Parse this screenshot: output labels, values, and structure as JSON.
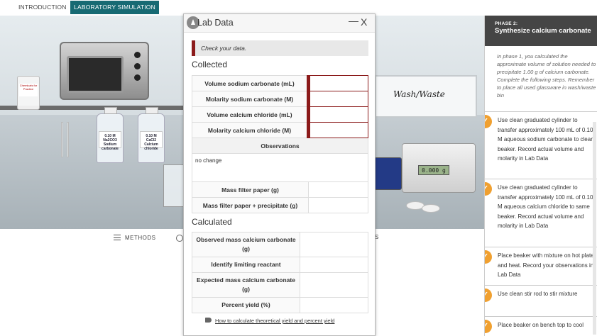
{
  "tabs": {
    "introduction": "INTRODUCTION",
    "simulation": "LABORATORY SIMULATION"
  },
  "scene": {
    "jar_label": "Chemicals for Practice",
    "bottle1_label": "0.10 M Na2CO3 Sodium carbonate",
    "bottle2_label": "0.10 M CaCl2 Calcium chloride",
    "wash_waste": "Wash/Waste",
    "scale_display": "0.000 g"
  },
  "toolbar": {
    "methods": "METHODS",
    "edge_s": "S"
  },
  "lab_data": {
    "title": "Lab Data",
    "minimize": "—",
    "close": "X",
    "notice": "Check your data.",
    "collected_title": "Collected",
    "collected_rows": [
      {
        "label": "Volume sodium carbonate (mL)",
        "value": ""
      },
      {
        "label": "Molarity sodium carbonate (M)",
        "value": ""
      },
      {
        "label": "Volume calcium chloride (mL)",
        "value": ""
      },
      {
        "label": "Molarity calcium chloride (M)",
        "value": ""
      }
    ],
    "observations_label": "Observations",
    "observations_value": "no change",
    "mass_rows": [
      {
        "label": "Mass filter paper (g)",
        "value": ""
      },
      {
        "label": "Mass filter paper + precipitate (g)",
        "value": ""
      }
    ],
    "calculated_title": "Calculated",
    "calculated_rows": [
      {
        "label": "Observed mass calcium carbonate (g)",
        "value": ""
      },
      {
        "label": "Identify limiting reactant",
        "value": ""
      },
      {
        "label": "Expected mass calcium carbonate (g)",
        "value": ""
      },
      {
        "label": "Percent yield (%)",
        "value": ""
      }
    ],
    "help_link": "How to calculate theoretical yield and percent yield"
  },
  "sidebar": {
    "phase_label": "PHASE 2:",
    "phase_title": "Synthesize calcium carbonate",
    "intro": "In phase 1, you calculated the approximate volume of solution needed to precipitate 1.00 g of calcium carbonate. Complete the following steps. Remember to place all used glassware in wash/waste bin",
    "check_glyph": "✓",
    "steps": [
      "Use clean graduated cylinder to transfer approximately 100 mL of 0.10 M aqueous sodium carbonate to clean beaker. Record actual volume and molarity in Lab Data",
      "Use clean graduated cylinder to transfer approximately 100 mL of 0.10 M aqueous calcium chloride to same beaker. Record actual volume and molarity in Lab Data",
      "Place beaker with mixture on hot plate and heat. Record your observations in Lab Data",
      "Use clean stir rod to stir mixture",
      "Place beaker on bench top to cool"
    ]
  },
  "colors": {
    "accent_teal": "#176a73",
    "error_red": "#8b1a1a",
    "check_orange": "#f0a030",
    "phase_bg": "#454545"
  }
}
